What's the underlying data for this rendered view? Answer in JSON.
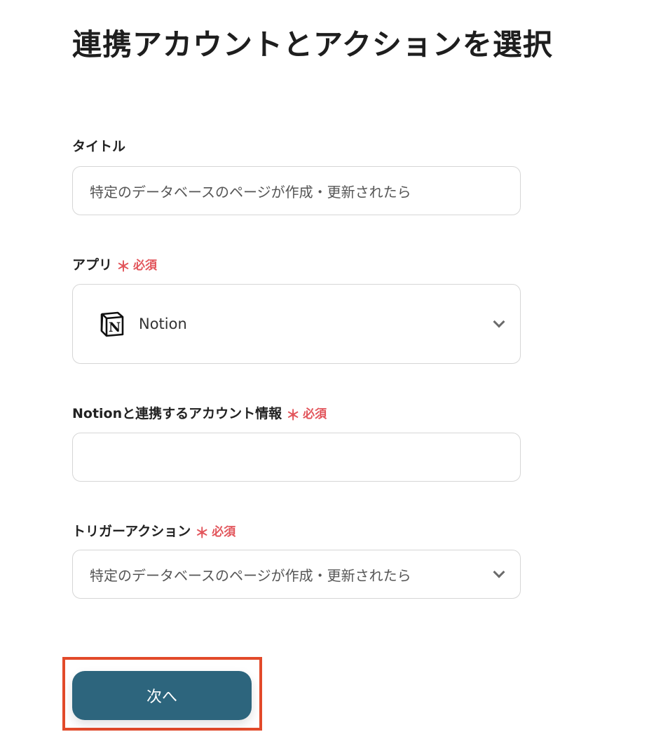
{
  "page": {
    "title": "連携アカウントとアクションを選択"
  },
  "fields": {
    "title": {
      "label": "タイトル",
      "value": "特定のデータベースのページが作成・更新されたら"
    },
    "app": {
      "label": "アプリ",
      "required_mark": "＊",
      "required_text": "必須",
      "selected": "Notion",
      "icon": "notion-logo-icon"
    },
    "account": {
      "label": "Notionと連携するアカウント情報",
      "required_mark": "＊",
      "required_text": "必須",
      "value": ""
    },
    "trigger": {
      "label": "トリガーアクション",
      "required_mark": "＊",
      "required_text": "必須",
      "selected": "特定のデータベースのページが作成・更新されたら"
    }
  },
  "actions": {
    "next_label": "次へ"
  },
  "colors": {
    "required": "#e2555b",
    "button_bg": "#2d657d",
    "highlight": "#e24a2a"
  }
}
